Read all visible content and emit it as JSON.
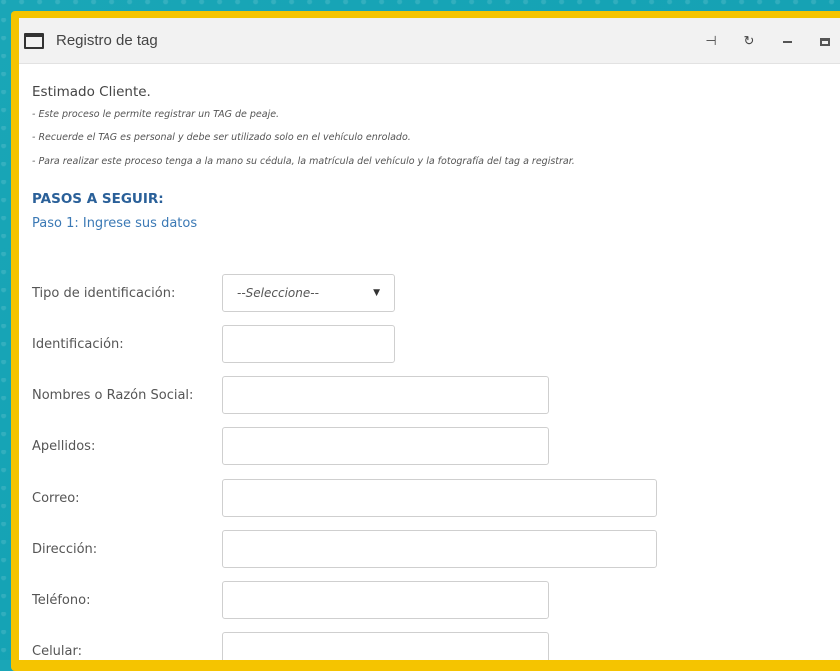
{
  "window": {
    "title": "Registro de tag",
    "actions": [
      "pin-icon",
      "refresh-icon",
      "minimize-icon",
      "maximize-icon"
    ]
  },
  "intro": {
    "greeting": "Estimado Cliente.",
    "notes": [
      "- Este proceso le permite registrar un TAG de peaje.",
      "- Recuerde el TAG es personal y debe ser utilizado solo en el vehículo enrolado.",
      "- Para realizar este proceso tenga a la mano su cédula, la matrícula del vehículo y la fotografía del tag a registrar."
    ]
  },
  "steps": {
    "title": "PASOS A SEGUIR:",
    "step1": "Paso 1: Ingrese sus datos"
  },
  "form": {
    "tipo_label": "Tipo de identificación:",
    "tipo_value": "--Seleccione--",
    "identificacion_label": "Identificación:",
    "nombres_label": "Nombres o Razón Social:",
    "apellidos_label": "Apellidos:",
    "correo_label": "Correo:",
    "direccion_label": "Dirección:",
    "telefono_label": "Teléfono:",
    "celular_label": "Celular:"
  },
  "colors": {
    "frame": "#f5c400",
    "background": "#1aa6b7",
    "heading": "#2a6099",
    "step": "#3b79b5"
  }
}
